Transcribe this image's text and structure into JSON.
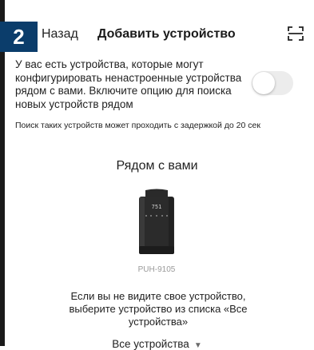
{
  "step_badge": "2",
  "header": {
    "back_label": "Назад",
    "title": "Добавить устройство",
    "scan_icon": "scan-icon"
  },
  "nearby_toggle": {
    "text": "У вас есть устройства, которые могут конфигурировать ненастроенные устройства рядом с вами. Включите опцию для поиска новых устройств рядом",
    "enabled": false
  },
  "search_note": "Поиск таких устройств может проходить с задержкой до 20 сек",
  "nearby": {
    "title": "Рядом с вами",
    "devices": [
      {
        "name": "PUH-9105",
        "screen_text": "751"
      }
    ]
  },
  "hint": "Если вы не видите свое устройство, выберите устройство из списка «Все устройства»",
  "all_devices": {
    "label": "Все устройства",
    "icon": "chevron-down-icon"
  },
  "colors": {
    "badge_bg": "#0b3d6b",
    "toggle_off": "#ececec",
    "device_body": "#2b2b2b"
  }
}
